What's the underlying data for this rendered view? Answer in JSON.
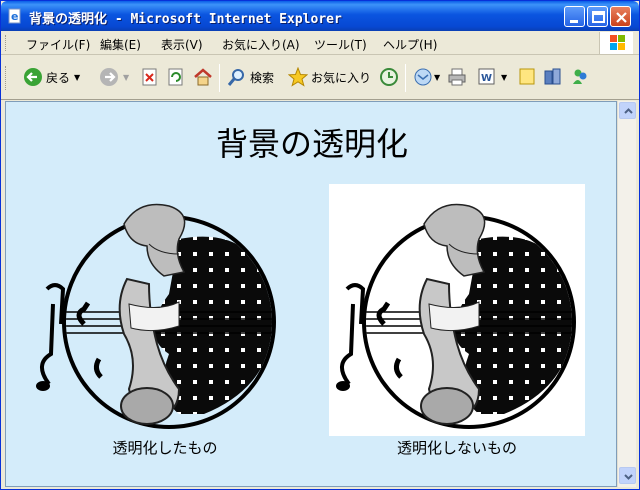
{
  "window": {
    "title": "背景の透明化 - Microsoft Internet Explorer"
  },
  "menu": {
    "items": [
      "ファイル(F)",
      "編集(E)",
      "表示(V)",
      "お気に入り(A)",
      "ツール(T)",
      "ヘルプ(H)"
    ]
  },
  "toolbar": {
    "back_label": "戻る",
    "search_label": "検索",
    "favorites_label": "お気に入り"
  },
  "page": {
    "heading": "背景の透明化",
    "images": [
      {
        "caption": "透明化したもの",
        "background": "transparent"
      },
      {
        "caption": "透明化しないもの",
        "background": "#ffffff"
      }
    ]
  },
  "colors": {
    "page_background": "#d4ecfa",
    "titlebar": "#0b55e0",
    "chrome": "#ece9d8"
  },
  "icons": [
    "ie-icon",
    "minimize-icon",
    "maximize-icon",
    "close-icon",
    "windows-logo-icon",
    "back-arrow-icon",
    "forward-arrow-icon",
    "stop-icon",
    "refresh-icon",
    "home-icon",
    "search-icon",
    "favorites-star-icon",
    "history-icon",
    "mail-icon",
    "print-icon",
    "edit-icon",
    "discuss-icon",
    "messenger-icon",
    "research-icon"
  ]
}
